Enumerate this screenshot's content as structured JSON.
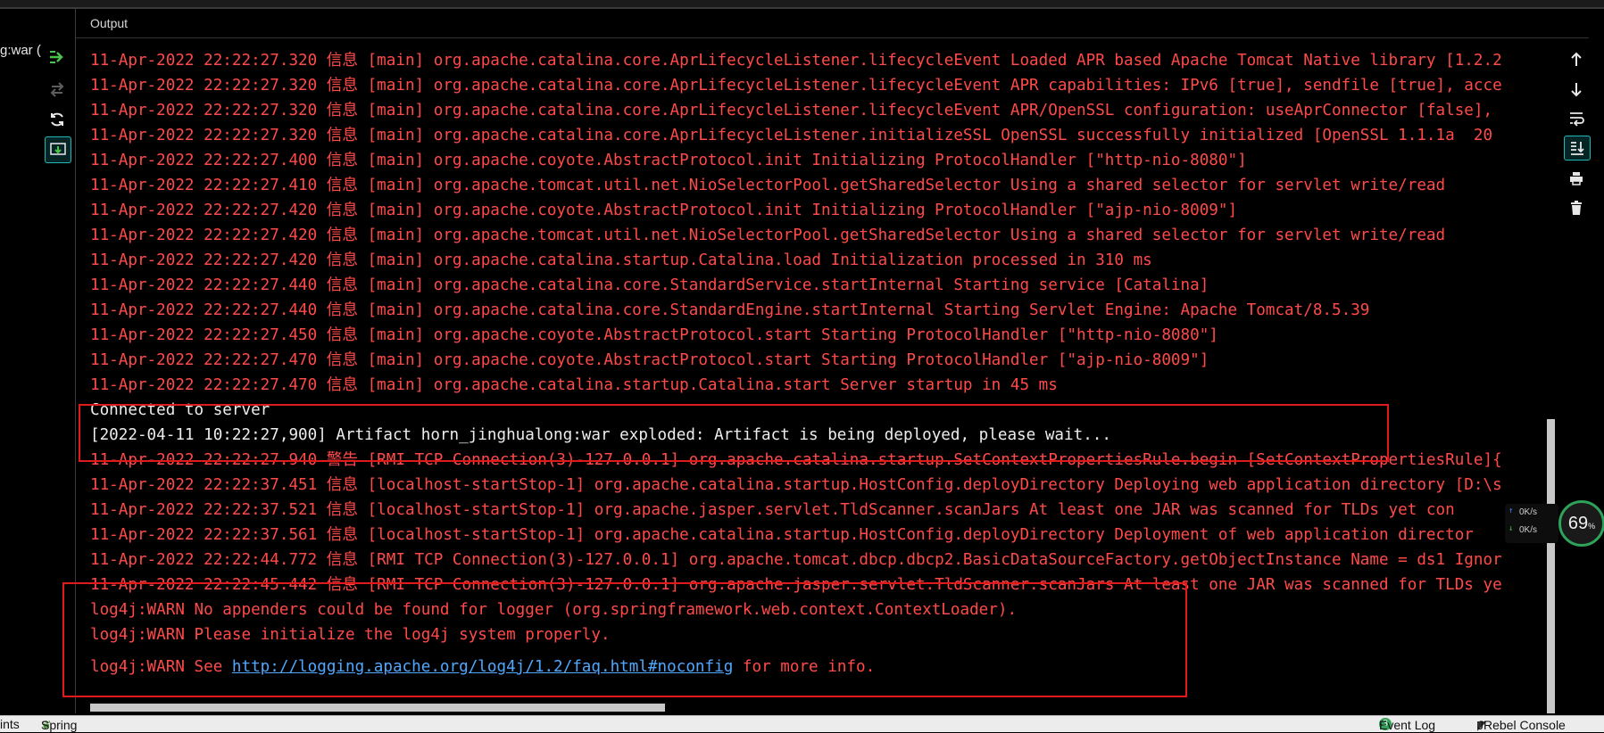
{
  "window": {
    "left_truncated_label": "g:war ("
  },
  "output_panel": {
    "title": "Output"
  },
  "console_lines": [
    {
      "text": "11-Apr-2022 22:22:27.320 信息 [main] org.apache.catalina.core.AprLifecycleListener.lifecycleEvent Loaded APR based Apache Tomcat Native library [1.2.2",
      "color": "red"
    },
    {
      "text": "11-Apr-2022 22:22:27.320 信息 [main] org.apache.catalina.core.AprLifecycleListener.lifecycleEvent APR capabilities: IPv6 [true], sendfile [true], acce",
      "color": "red"
    },
    {
      "text": "11-Apr-2022 22:22:27.320 信息 [main] org.apache.catalina.core.AprLifecycleListener.lifecycleEvent APR/OpenSSL configuration: useAprConnector [false],",
      "color": "red"
    },
    {
      "text": "11-Apr-2022 22:22:27.320 信息 [main] org.apache.catalina.core.AprLifecycleListener.initializeSSL OpenSSL successfully initialized [OpenSSL 1.1.1a  20",
      "color": "red"
    },
    {
      "text": "11-Apr-2022 22:22:27.400 信息 [main] org.apache.coyote.AbstractProtocol.init Initializing ProtocolHandler [\"http-nio-8080\"]",
      "color": "red"
    },
    {
      "text": "11-Apr-2022 22:22:27.410 信息 [main] org.apache.tomcat.util.net.NioSelectorPool.getSharedSelector Using a shared selector for servlet write/read",
      "color": "red"
    },
    {
      "text": "11-Apr-2022 22:22:27.420 信息 [main] org.apache.coyote.AbstractProtocol.init Initializing ProtocolHandler [\"ajp-nio-8009\"]",
      "color": "red"
    },
    {
      "text": "11-Apr-2022 22:22:27.420 信息 [main] org.apache.tomcat.util.net.NioSelectorPool.getSharedSelector Using a shared selector for servlet write/read",
      "color": "red"
    },
    {
      "text": "11-Apr-2022 22:22:27.420 信息 [main] org.apache.catalina.startup.Catalina.load Initialization processed in 310 ms",
      "color": "red"
    },
    {
      "text": "11-Apr-2022 22:22:27.440 信息 [main] org.apache.catalina.core.StandardService.startInternal Starting service [Catalina]",
      "color": "red"
    },
    {
      "text": "11-Apr-2022 22:22:27.440 信息 [main] org.apache.catalina.core.StandardEngine.startInternal Starting Servlet Engine: Apache Tomcat/8.5.39",
      "color": "red"
    },
    {
      "text": "11-Apr-2022 22:22:27.450 信息 [main] org.apache.coyote.AbstractProtocol.start Starting ProtocolHandler [\"http-nio-8080\"]",
      "color": "red"
    },
    {
      "text": "11-Apr-2022 22:22:27.470 信息 [main] org.apache.coyote.AbstractProtocol.start Starting ProtocolHandler [\"ajp-nio-8009\"]",
      "color": "red"
    },
    {
      "text": "11-Apr-2022 22:22:27.470 信息 [main] org.apache.catalina.startup.Catalina.start Server startup in 45 ms",
      "color": "red"
    },
    {
      "text": "Connected to server",
      "color": "white"
    },
    {
      "text": "[2022-04-11 10:22:27,900] Artifact horn_jinghualong:war exploded: Artifact is being deployed, please wait...",
      "color": "white"
    },
    {
      "text": "11-Apr-2022 22:22:27.940 警告 [RMI TCP Connection(3)-127.0.0.1] org.apache.catalina.startup.SetContextPropertiesRule.begin [SetContextPropertiesRule]{",
      "color": "red"
    },
    {
      "text": "11-Apr-2022 22:22:37.451 信息 [localhost-startStop-1] org.apache.catalina.startup.HostConfig.deployDirectory Deploying web application directory [D:\\s",
      "color": "red"
    },
    {
      "text": "11-Apr-2022 22:22:37.521 信息 [localhost-startStop-1] org.apache.jasper.servlet.TldScanner.scanJars At least one JAR was scanned for TLDs yet con",
      "color": "red"
    },
    {
      "text": "11-Apr-2022 22:22:37.561 信息 [localhost-startStop-1] org.apache.catalina.startup.HostConfig.deployDirectory Deployment of web application director",
      "color": "red"
    },
    {
      "text": "11-Apr-2022 22:22:44.772 信息 [RMI TCP Connection(3)-127.0.0.1] org.apache.tomcat.dbcp.dbcp2.BasicDataSourceFactory.getObjectInstance Name = ds1 Ignor",
      "color": "red"
    },
    {
      "text": "11-Apr-2022 22:22:45.442 信息 [RMI TCP Connection(3)-127.0.0.1] org.apache.jasper.servlet.TldScanner.scanJars At least one JAR was scanned for TLDs ye",
      "color": "red"
    },
    {
      "text": "log4j:WARN No appenders could be found for logger (org.springframework.web.context.ContextLoader).",
      "color": "red"
    },
    {
      "text": "log4j:WARN Please initialize the log4j system properly.",
      "color": "red"
    }
  ],
  "last_line": {
    "prefix": "log4j:WARN See ",
    "link": "http://logging.apache.org/log4j/1.2/faq.html#noconfig",
    "suffix": " for more info."
  },
  "net_widget": {
    "up": "0K/s",
    "down": "0K/s",
    "percent": "69",
    "percent_unit": "%"
  },
  "status_bar": {
    "left_label": "ints",
    "spring_label": "Spring",
    "event_log_count": "3",
    "event_log_label": "Event Log",
    "jrebel_label": "JRebel Console"
  },
  "colors": {
    "log_red": "#ff4a4a",
    "log_white": "#ededed",
    "link_blue": "#4fa8ff",
    "highlight_red": "#e0191b"
  }
}
